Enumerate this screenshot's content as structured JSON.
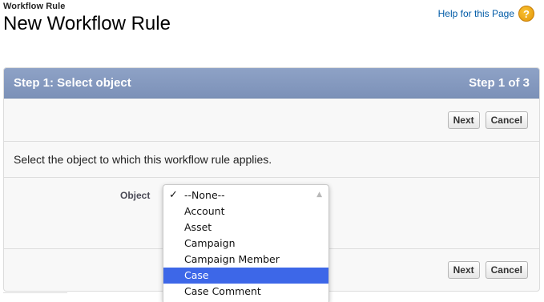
{
  "header": {
    "page_type": "Workflow Rule",
    "title": "New Workflow Rule",
    "help_label": "Help for this Page",
    "help_icon": "question-icon"
  },
  "panel": {
    "step_title": "Step 1: Select object",
    "step_count": "Step 1 of 3",
    "next_label": "Next",
    "cancel_label": "Cancel",
    "instruction": "Select the object to which this workflow rule applies.",
    "object_label": "Object"
  },
  "dropdown": {
    "check_mark": "✓",
    "options": [
      {
        "label": "--None--",
        "checked": true
      },
      {
        "label": "Account"
      },
      {
        "label": "Asset"
      },
      {
        "label": "Campaign"
      },
      {
        "label": "Campaign Member"
      },
      {
        "label": "Case",
        "highlighted": true
      },
      {
        "label": "Case Comment"
      }
    ]
  },
  "colors": {
    "header_bar": "#7c91b8",
    "link": "#015ba7",
    "highlight": "#3d67e8"
  }
}
